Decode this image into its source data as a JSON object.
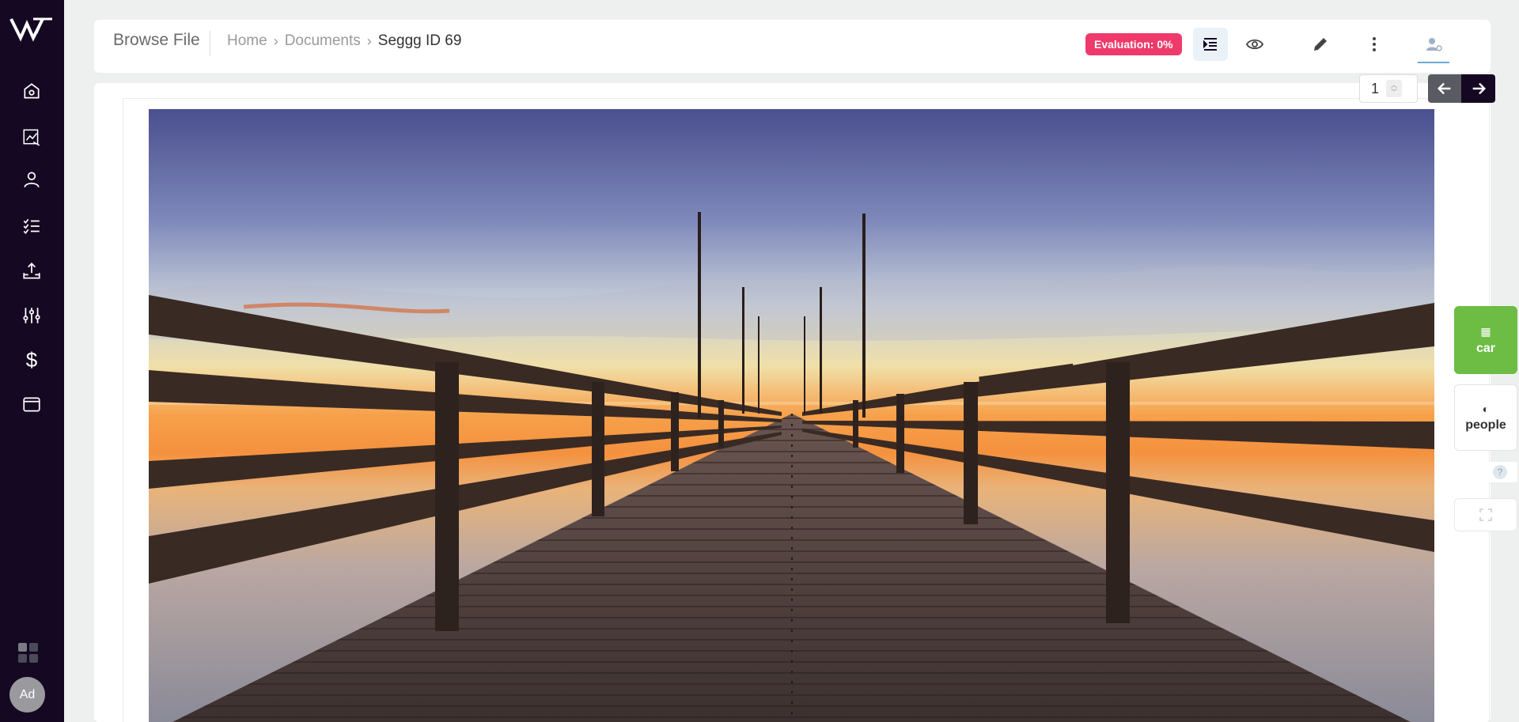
{
  "header": {
    "title": "Browse File",
    "breadcrumb": [
      "Home",
      "Documents",
      "Seggg ID 69"
    ],
    "evaluation_badge": "Evaluation: 0%"
  },
  "sidebar": {
    "items": [
      "home-icon",
      "analytics-icon",
      "user-icon",
      "checklist-icon",
      "upload-icon",
      "sliders-icon",
      "dollar-icon",
      "wallet-icon"
    ],
    "dollar_glyph": "$",
    "avatar_initials": "Ad"
  },
  "pagination": {
    "current_page": "1"
  },
  "tags": [
    {
      "label": "car",
      "color": "#6dbd45",
      "icon": "tag-icon"
    },
    {
      "label": "people",
      "color": "#ffffff",
      "icon": "contrast-icon"
    }
  ],
  "help_glyph": "?",
  "colors": {
    "sidebar": "#150822",
    "badge": "#ee3a6a",
    "active_tag": "#6dbd45"
  }
}
